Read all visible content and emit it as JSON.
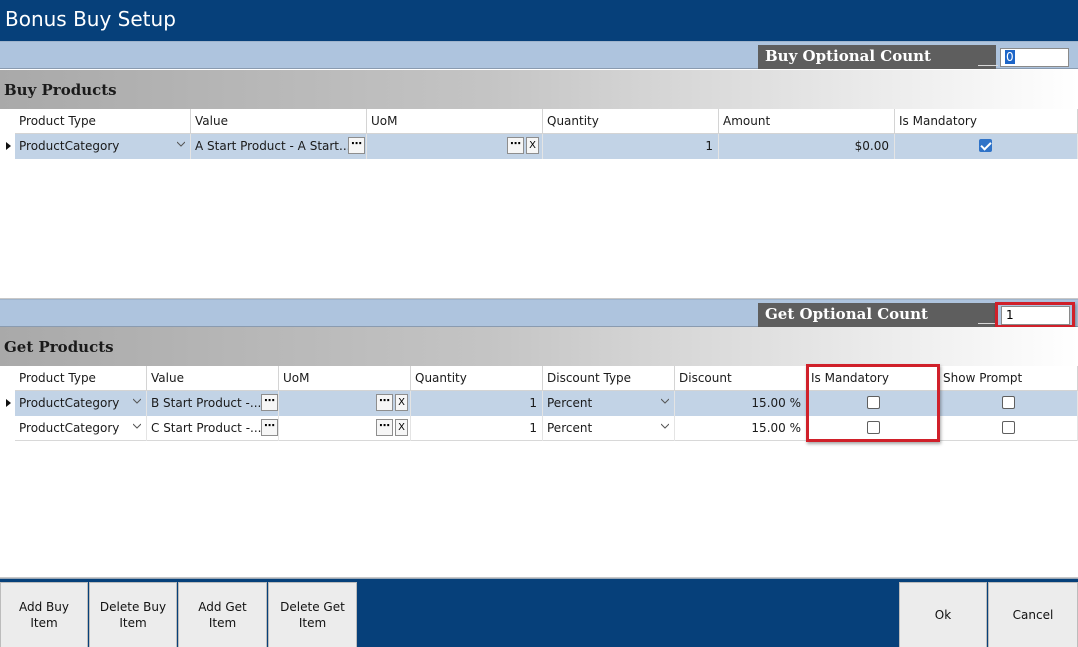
{
  "window": {
    "title": "Bonus Buy Setup"
  },
  "buy_optional": {
    "label": "Buy Optional Count",
    "value": "0"
  },
  "buy_products": {
    "title": "Buy Products",
    "columns": [
      "Product Type",
      "Value",
      "UoM",
      "Quantity",
      "Amount",
      "Is Mandatory"
    ],
    "rows": [
      {
        "product_type": "ProductCategory",
        "value": "A Start Product - A Start...",
        "uom": "",
        "quantity": "1",
        "amount": "$0.00",
        "is_mandatory": true
      }
    ]
  },
  "get_optional": {
    "label": "Get Optional Count",
    "value": "1"
  },
  "get_products": {
    "title": "Get Products",
    "columns": [
      "Product Type",
      "Value",
      "UoM",
      "Quantity",
      "Discount Type",
      "Discount",
      "Is Mandatory",
      "Show Prompt"
    ],
    "rows": [
      {
        "product_type": "ProductCategory",
        "value": "B Start Product -...",
        "uom": "",
        "quantity": "1",
        "discount_type": "Percent",
        "discount": "15.00 %",
        "is_mandatory": false,
        "show_prompt": false
      },
      {
        "product_type": "ProductCategory",
        "value": "C Start Product -...",
        "uom": "",
        "quantity": "1",
        "discount_type": "Percent",
        "discount": "15.00 %",
        "is_mandatory": false,
        "show_prompt": false
      }
    ]
  },
  "buttons": {
    "add_buy": "Add Buy Item",
    "delete_buy": "Delete Buy Item",
    "add_get": "Add Get Item",
    "delete_get": "Delete Get Item",
    "ok": "Ok",
    "cancel": "Cancel"
  },
  "icons": {
    "ellipsis": "⋯",
    "clear": "X",
    "row_indicator": "row-pointer-icon",
    "dropdown": "chevron-down-icon"
  },
  "colors": {
    "title_bar": "#06407a",
    "highlight_box": "#d0202a",
    "selected_row": "#c2d3e6",
    "checkbox_on": "#2f73c8"
  }
}
